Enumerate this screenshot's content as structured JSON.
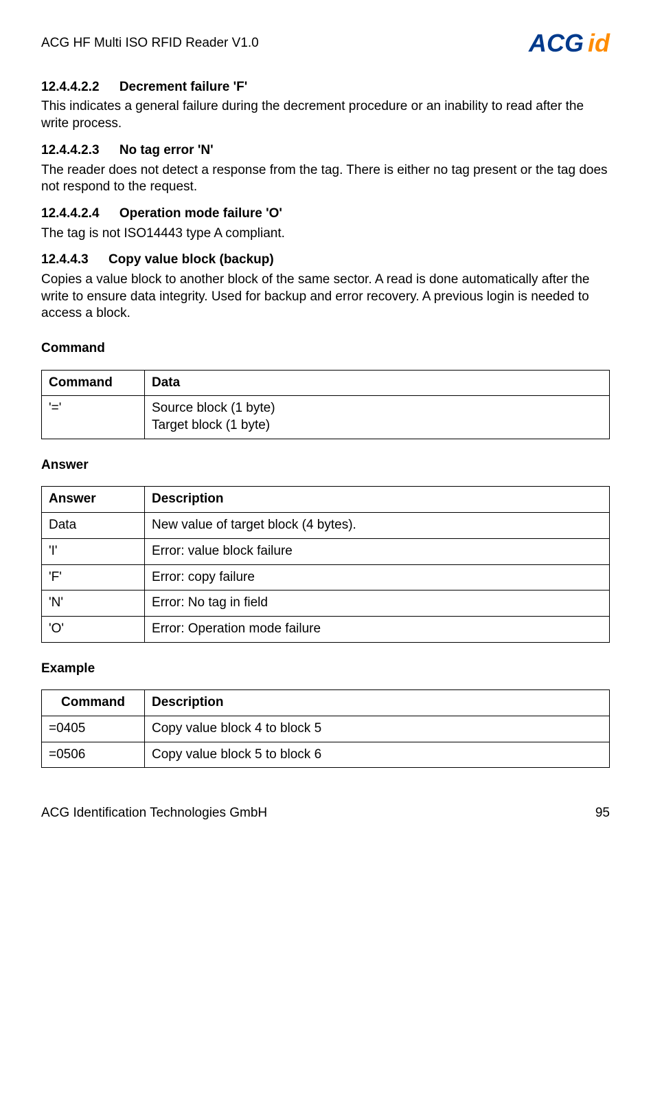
{
  "header": {
    "doc_title": "ACG HF Multi ISO RFID Reader V1.0",
    "logo_primary": "ACG",
    "logo_accent": "id"
  },
  "sections": {
    "s1": {
      "num": "12.4.4.2.2",
      "title": "Decrement failure 'F'",
      "body": "This indicates a general failure during the decrement procedure or an inability to read after the write process."
    },
    "s2": {
      "num": "12.4.4.2.3",
      "title": "No tag error 'N'",
      "body": "The reader does not detect a response from the tag. There is either no tag present or the tag does not respond to the request."
    },
    "s3": {
      "num": "12.4.4.2.4",
      "title": "Operation mode failure 'O'",
      "body": "The tag is not ISO14443 type A compliant."
    },
    "s4": {
      "num": "12.4.4.3",
      "title": "Copy value block (backup)",
      "body": "Copies a value block to another block of the same sector. A read is done automatically after the write to ensure data integrity. Used for backup and error recovery. A previous login is needed to access a block."
    }
  },
  "labels": {
    "command": "Command",
    "data": "Data",
    "answer": "Answer",
    "description": "Description",
    "example": "Example"
  },
  "command_table": {
    "row": {
      "command": "'='",
      "data_line1": "Source block (1 byte)",
      "data_line2": "Target block (1 byte)"
    }
  },
  "answer_table": {
    "rows": [
      {
        "answer": "Data",
        "description": "New value of target block (4 bytes)."
      },
      {
        "answer": "'I'",
        "description": "Error: value block failure"
      },
      {
        "answer": "'F'",
        "description": "Error: copy failure"
      },
      {
        "answer": "'N'",
        "description": "Error: No tag in field"
      },
      {
        "answer": "'O'",
        "description": "Error: Operation mode failure"
      }
    ]
  },
  "example_table": {
    "rows": [
      {
        "command": "=0405",
        "description": "Copy value block 4 to block 5"
      },
      {
        "command": "=0506",
        "description": "Copy value block 5 to block 6"
      }
    ]
  },
  "footer": {
    "company": "ACG Identification Technologies GmbH",
    "page": "95"
  }
}
